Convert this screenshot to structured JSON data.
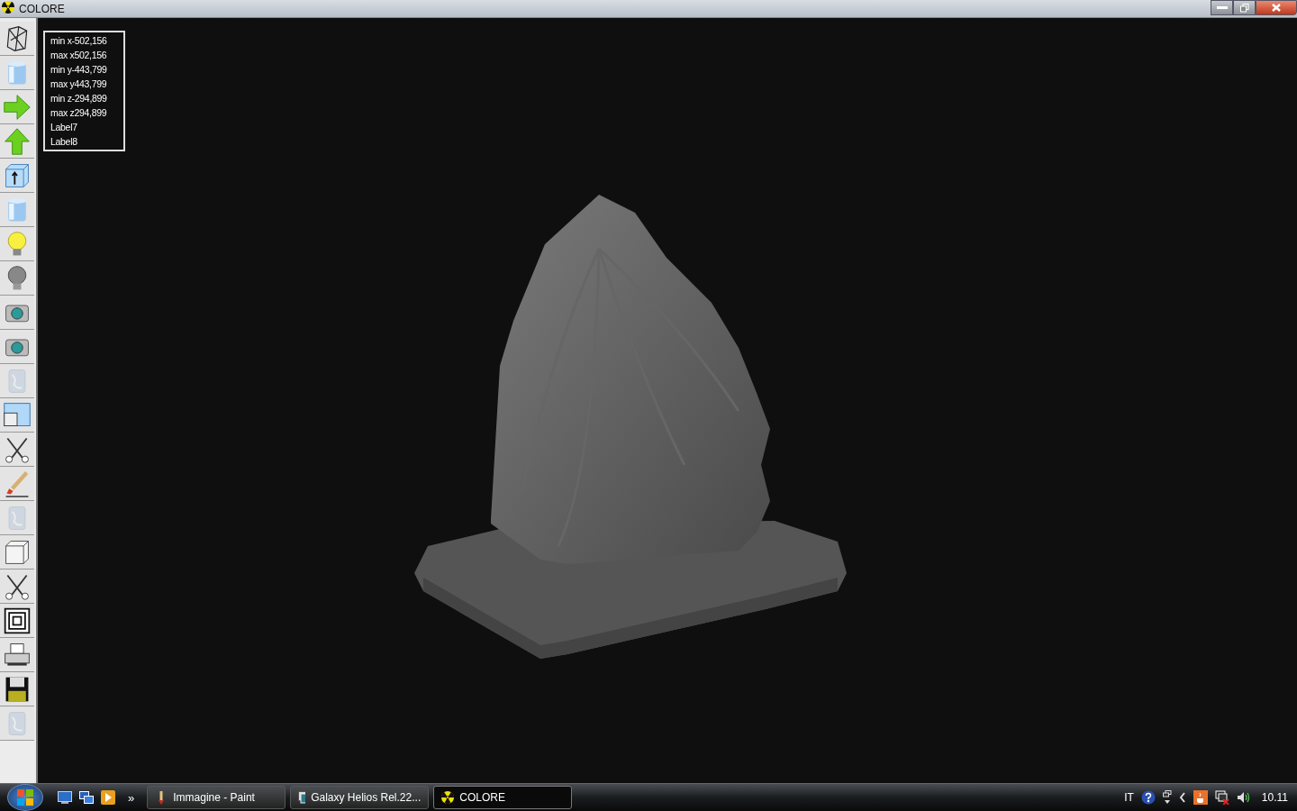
{
  "window": {
    "title": "COLORE"
  },
  "toolbar": [
    {
      "kind": "wireframe",
      "disabled": false
    },
    {
      "kind": "cylinder",
      "disabled": false
    },
    {
      "kind": "arrow-right",
      "disabled": false
    },
    {
      "kind": "arrow-up",
      "disabled": false
    },
    {
      "kind": "cube-arrow",
      "disabled": false
    },
    {
      "kind": "cylinder",
      "disabled": false
    },
    {
      "kind": "bulb-on",
      "disabled": false
    },
    {
      "kind": "bulb-off",
      "disabled": false
    },
    {
      "kind": "camera",
      "disabled": false
    },
    {
      "kind": "camera",
      "disabled": false
    },
    {
      "kind": "blank",
      "disabled": true
    },
    {
      "kind": "window",
      "disabled": false
    },
    {
      "kind": "scissors",
      "disabled": false
    },
    {
      "kind": "brush",
      "disabled": false
    },
    {
      "kind": "blank",
      "disabled": true
    },
    {
      "kind": "cube",
      "disabled": false
    },
    {
      "kind": "scissors",
      "disabled": false
    },
    {
      "kind": "squares",
      "disabled": false
    },
    {
      "kind": "printer",
      "disabled": false
    },
    {
      "kind": "floppy",
      "disabled": false
    },
    {
      "kind": "blank",
      "disabled": true
    }
  ],
  "info_labels": [
    "min x-502,156",
    "max x502,156",
    "min y-443,799",
    "max y443,799",
    "min z-294,899",
    "max z294,899",
    "Label7",
    "Label8"
  ],
  "taskbar": {
    "overflow": "»",
    "tasks": [
      {
        "label": "Immagine - Paint",
        "kind": "paint",
        "selected": false
      },
      {
        "label": "Galaxy Helios  Rel.22...",
        "kind": "app",
        "selected": false
      },
      {
        "label": "COLORE",
        "kind": "radiation",
        "selected": true
      }
    ],
    "language": "IT",
    "clock": "10.11"
  }
}
